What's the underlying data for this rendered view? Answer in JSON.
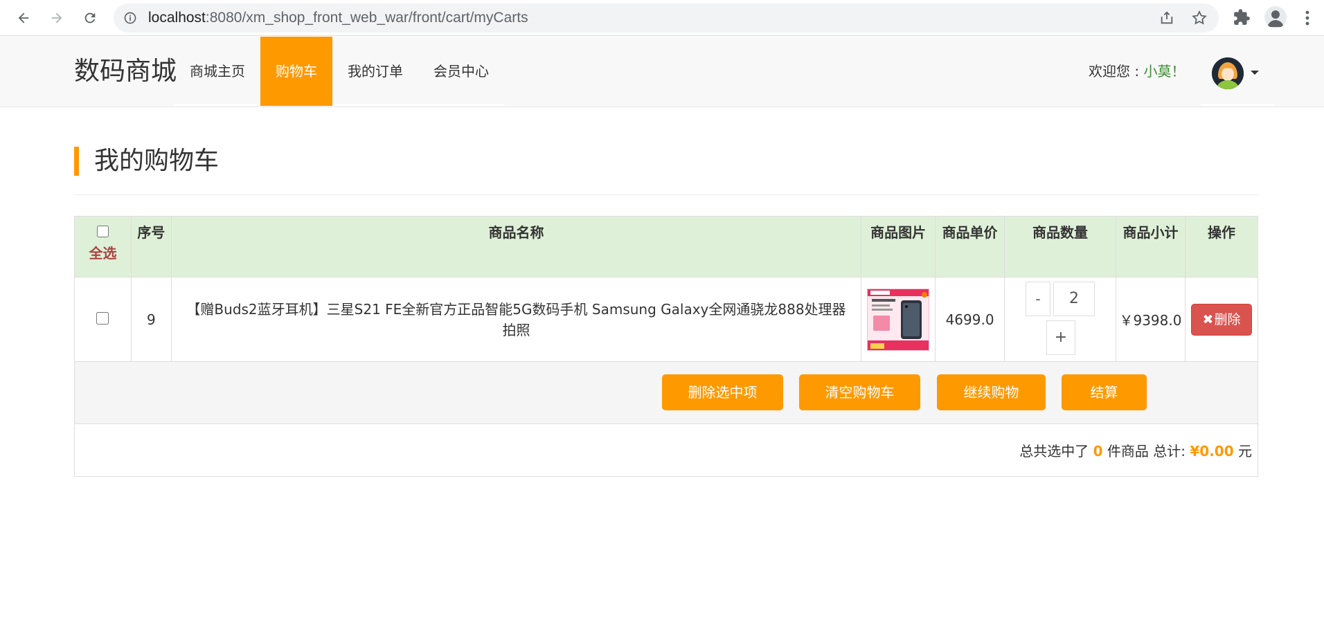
{
  "browser": {
    "url_host": "localhost",
    "url_path": ":8080/xm_shop_front_web_war/front/cart/myCarts"
  },
  "navbar": {
    "brand": "数码商城",
    "links": [
      {
        "label": "商城主页"
      },
      {
        "label": "购物车",
        "active": true
      },
      {
        "label": "我的订单"
      },
      {
        "label": "会员中心"
      }
    ],
    "welcome_prefix": "欢迎您 : ",
    "username": "小莫！"
  },
  "page": {
    "title": "我的购物车"
  },
  "table": {
    "headers": {
      "select_all": "全选",
      "index": "序号",
      "name": "商品名称",
      "image": "商品图片",
      "price": "商品单价",
      "quantity": "商品数量",
      "subtotal": "商品小计",
      "operation": "操作"
    },
    "rows": [
      {
        "index": "9",
        "name": "【赠Buds2蓝牙耳机】三星S21 FE全新官方正品智能5G数码手机 Samsung Galaxy全网通骁龙888处理器拍照",
        "price": "4699.0",
        "minus": "-",
        "quantity": "2",
        "plus": "+",
        "subtotal": "￥9398.0",
        "delete_label": "删除"
      }
    ],
    "actions": {
      "delete_selected": "删除选中项",
      "clear_cart": "清空购物车",
      "continue_shopping": "继续购物",
      "checkout": "结算"
    },
    "summary": {
      "prefix": "总共选中了",
      "count": "0",
      "mid": "件商品 总计:",
      "total": "¥0.00",
      "unit": "元"
    }
  },
  "colors": {
    "accent": "#ff9900",
    "header_bg": "#dff0d8",
    "danger": "#d9534f",
    "username": "#3c8d2f"
  }
}
